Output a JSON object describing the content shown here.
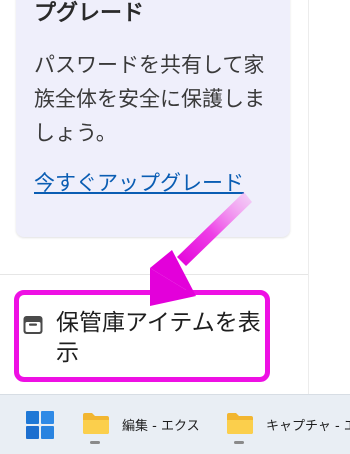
{
  "promo": {
    "title": "プグレード",
    "body": "パスワードを共有して家族全体を安全に保護しましょう。",
    "link": "今すぐアップグレード"
  },
  "vault_button": {
    "label": "保管庫アイテムを表示",
    "icon": "vault-icon"
  },
  "annotation": {
    "color": "#ee10e4"
  },
  "taskbar": {
    "start_icon": "windows-start-icon",
    "items": [
      {
        "label": "編集 - エクス",
        "icon": "folder-icon"
      },
      {
        "label": "キャプチャ - エ",
        "icon": "folder-icon"
      }
    ]
  }
}
